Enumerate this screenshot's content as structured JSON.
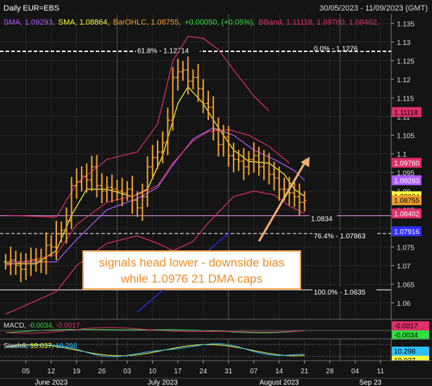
{
  "header": {
    "title": "Daily EUR=EBS",
    "date_range": "30/05/2023 - 11/09/2023 (GMT)"
  },
  "legend": [
    {
      "text": "SMA, 1.09293,",
      "color": "#b05cff"
    },
    {
      "text": "SMA, 1.08864,",
      "color": "#ffff40"
    },
    {
      "text": "BarOHLC, 1.08755,",
      "color": "#f0a030"
    },
    {
      "text": "+0.00050, (+0.05%),",
      "color": "#30e040"
    },
    {
      "text": "BBand, 1.11118, 1.09760, 1.08402,",
      "color": "#e0306a"
    }
  ],
  "annotation_box": {
    "line1": "signals head lower - downside bias",
    "line2": "while 1.0976 21 DMA caps"
  },
  "chart_data": {
    "type": "line",
    "title": "Daily EUR=EBS",
    "subtitle": "30/05/2023 - 11/09/2023 (GMT)",
    "ylim": [
      1.0575,
      1.1375
    ],
    "y_ticks": [
      1.06,
      1.065,
      1.07,
      1.075,
      1.08,
      1.085,
      1.09,
      1.095,
      1.1,
      1.105,
      1.11,
      1.115,
      1.12,
      1.125,
      1.13,
      1.135
    ],
    "y_tick_labels": [
      "1.06",
      "1.065",
      "1.07",
      "1.075",
      "1.08",
      "1.085",
      "1.09",
      "1.095",
      "1.1",
      "1.105",
      "1.11",
      "1.115",
      "1.12",
      "1.125",
      "1.13",
      "1.135"
    ],
    "x_day_labels": [
      {
        "i": 4,
        "label": "05"
      },
      {
        "i": 9,
        "label": "12"
      },
      {
        "i": 14,
        "label": "19"
      },
      {
        "i": 19,
        "label": "26"
      },
      {
        "i": 24,
        "label": "03"
      },
      {
        "i": 29,
        "label": "10"
      },
      {
        "i": 34,
        "label": "17"
      },
      {
        "i": 39,
        "label": "24"
      },
      {
        "i": 44,
        "label": "31"
      },
      {
        "i": 49,
        "label": "07"
      },
      {
        "i": 54,
        "label": "14"
      },
      {
        "i": 59,
        "label": "21"
      },
      {
        "i": 64,
        "label": "28"
      },
      {
        "i": 69,
        "label": "04"
      },
      {
        "i": 74,
        "label": "11"
      }
    ],
    "x_month_labels": [
      {
        "i": 9,
        "label": "June 2023"
      },
      {
        "i": 31,
        "label": "July 2023"
      },
      {
        "i": 54,
        "label": "August 2023"
      },
      {
        "i": 72,
        "label": "Sep 23"
      }
    ],
    "month_separators": [
      22,
      44,
      66
    ],
    "last_index": 59,
    "ohlc_close": [
      1.071,
      1.0715,
      1.07,
      1.069,
      1.0705,
      1.0715,
      1.0715,
      1.071,
      1.0755,
      1.075,
      1.0785,
      1.0795,
      1.082,
      1.0915,
      1.0925,
      1.094,
      1.093,
      1.0965,
      1.0915,
      1.09,
      1.091,
      1.0905,
      1.09,
      1.0895,
      1.0905,
      1.0875,
      1.0855,
      1.0885,
      1.0965,
      1.099,
      1.1005,
      1.103,
      1.109,
      1.1205,
      1.122,
      1.1225,
      1.1195,
      1.1205,
      1.1175,
      1.1135,
      1.1125,
      1.1065,
      1.1025,
      1.1045,
      1.0995,
      1.0985,
      1.098,
      1.0965,
      1.0985,
      1.0995,
      1.0965,
      1.0975,
      1.0945,
      1.0935,
      1.0905,
      1.0905,
      1.0895,
      1.0885,
      1.087,
      1.0875
    ],
    "series": [
      {
        "name": "SMA",
        "last": "1.09293",
        "color": "#b05cff",
        "points": [
          [
            0,
            1.071
          ],
          [
            10,
            1.071
          ],
          [
            14,
            1.077
          ],
          [
            20,
            1.085
          ],
          [
            26,
            1.088
          ],
          [
            30,
            1.091
          ],
          [
            33,
            1.097
          ],
          [
            37,
            1.104
          ],
          [
            41,
            1.107
          ],
          [
            45,
            1.105
          ],
          [
            49,
            1.101
          ],
          [
            53,
            1.0985
          ],
          [
            57,
            1.0955
          ],
          [
            59,
            1.0929
          ]
        ]
      },
      {
        "name": "SMA",
        "last": "1.08864",
        "color": "#ffff40",
        "points": [
          [
            0,
            1.0705
          ],
          [
            6,
            1.0705
          ],
          [
            10,
            1.074
          ],
          [
            13,
            1.0835
          ],
          [
            16,
            1.0905
          ],
          [
            20,
            1.0905
          ],
          [
            25,
            1.0885
          ],
          [
            28,
            1.0905
          ],
          [
            31,
            1.0995
          ],
          [
            34,
            1.1135
          ],
          [
            36,
            1.118
          ],
          [
            39,
            1.1135
          ],
          [
            42,
            1.107
          ],
          [
            45,
            1.101
          ],
          [
            48,
            1.098
          ],
          [
            52,
            1.0975
          ],
          [
            55,
            1.0945
          ],
          [
            57,
            1.0905
          ],
          [
            59,
            1.0886
          ]
        ]
      },
      {
        "name": "BBand",
        "last": "1.11118",
        "color": "#e0306a",
        "points": [
          [
            0,
            1.0835
          ],
          [
            10,
            1.083
          ],
          [
            14,
            1.092
          ],
          [
            20,
            1.0985
          ],
          [
            26,
            1.1005
          ],
          [
            30,
            1.108
          ],
          [
            33,
            1.125
          ],
          [
            36,
            1.1315
          ],
          [
            39,
            1.131
          ],
          [
            42,
            1.128
          ],
          [
            45,
            1.1225
          ],
          [
            49,
            1.1155
          ],
          [
            52,
            1.1115
          ]
        ]
      },
      {
        "name": "BBand",
        "last": "1.09760",
        "color": "#e0306a",
        "points": [
          [
            0,
            1.07
          ],
          [
            10,
            1.073
          ],
          [
            14,
            1.081
          ],
          [
            20,
            1.087
          ],
          [
            26,
            1.089
          ],
          [
            30,
            1.0915
          ],
          [
            33,
            1.0975
          ],
          [
            37,
            1.1035
          ],
          [
            40,
            1.106
          ],
          [
            44,
            1.1065
          ],
          [
            48,
            1.105
          ],
          [
            52,
            1.102
          ],
          [
            56,
            1.0975
          ]
        ]
      },
      {
        "name": "BBand",
        "last": "1.08402",
        "color": "#e0306a",
        "points": [
          [
            0,
            1.057
          ],
          [
            10,
            1.063
          ],
          [
            14,
            1.07
          ],
          [
            20,
            1.076
          ],
          [
            26,
            1.078
          ],
          [
            30,
            1.076
          ],
          [
            33,
            1.074
          ],
          [
            37,
            1.0765
          ],
          [
            40,
            1.0815
          ],
          [
            45,
            1.0885
          ],
          [
            49,
            1.09
          ],
          [
            53,
            1.089
          ],
          [
            56,
            1.086
          ],
          [
            59,
            1.084
          ]
        ]
      }
    ],
    "horizontal_levels": [
      {
        "label": "0.0% - 1.1276",
        "value": 1.1276,
        "style": "dashed"
      },
      {
        "label": "61.8% - 1.12714",
        "value": 1.1274,
        "style": "dashed"
      },
      {
        "label": "1.0834",
        "value": 1.0834,
        "style": "solid"
      },
      {
        "label": "76.4% - 1.07863",
        "value": 1.0786,
        "style": "dashed"
      },
      {
        "label": "100.0% - 1.0635",
        "value": 1.0635,
        "style": "solid"
      }
    ],
    "trend_line": {
      "points": [
        [
          26,
          1.0575
        ],
        [
          44,
          1.0787
        ]
      ],
      "color": "#3030ff"
    },
    "arrow": {
      "from": [
        50,
        1.0765
      ],
      "to": [
        60,
        1.0992
      ],
      "color": "#f0b070"
    },
    "price_tags": [
      {
        "text": "1.11118",
        "value": 1.1112,
        "bg": "#e0306a",
        "fg": "#000000"
      },
      {
        "text": "1.09760",
        "value": 1.0976,
        "bg": "#e0306a",
        "fg": "#ffffff"
      },
      {
        "text": "1.09293",
        "value": 1.0929,
        "bg": "#b05cff",
        "fg": "#ffffff"
      },
      {
        "text": "1.08864",
        "value": 1.0886,
        "bg": "#ffff40",
        "fg": "#000000"
      },
      {
        "text": "1.08755",
        "value": 1.08755,
        "bg": "#f0a030",
        "fg": "#000000"
      },
      {
        "text": "1.08402",
        "value": 1.084,
        "bg": "#e0306a",
        "fg": "#ffffff"
      },
      {
        "text": "1.07916",
        "value": 1.0792,
        "bg": "#3030ff",
        "fg": "#ffffff"
      }
    ],
    "macd": {
      "label": "MACD",
      "values": [
        "-0.0034",
        "-0.0017"
      ],
      "colors": [
        "#30e040",
        "#e0306a"
      ],
      "tags": [
        {
          "text": "-0.0017",
          "bg": "#e0306a",
          "fg": "#000000"
        },
        {
          "text": "-0.0034",
          "bg": "#30e040",
          "fg": "#000000"
        }
      ]
    },
    "stochs": {
      "label": "StochS",
      "values": [
        "10.037",
        "10.298"
      ],
      "colors": [
        "#ffff40",
        "#30c0ff"
      ],
      "tags": [
        {
          "text": "10.298",
          "bg": "#30c0ff",
          "fg": "#000000"
        },
        {
          "text": "10.037",
          "bg": "#ffff40",
          "fg": "#000000"
        }
      ]
    }
  }
}
